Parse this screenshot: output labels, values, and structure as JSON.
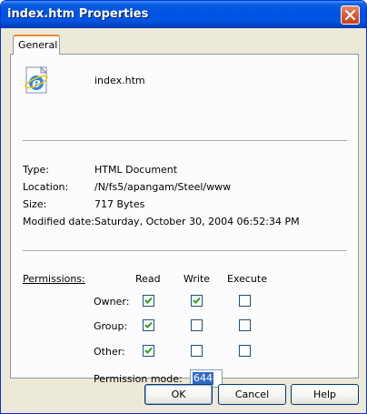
{
  "window": {
    "title": "index.htm Properties",
    "close_icon": "close-icon"
  },
  "tabs": [
    {
      "label": "General",
      "selected": true
    }
  ],
  "file": {
    "icon": "ie-html-file-icon",
    "name": "index.htm"
  },
  "properties": [
    {
      "label": "Type:",
      "value": "HTML Document"
    },
    {
      "label": "Location:",
      "value": "/N/fs5/apangam/Steel/www"
    },
    {
      "label": "Size:",
      "value": "717 Bytes"
    },
    {
      "label": "Modified date:",
      "value": "Saturday, October 30, 2004 06:52:34 PM"
    }
  ],
  "permissions": {
    "label": "Permissions:",
    "columns": [
      "Read",
      "Write",
      "Execute"
    ],
    "rows": [
      {
        "label": "Owner:",
        "read": true,
        "write": true,
        "execute": false
      },
      {
        "label": "Group:",
        "read": true,
        "write": false,
        "execute": false
      },
      {
        "label": "Other:",
        "read": true,
        "write": false,
        "execute": false
      }
    ],
    "mode_label": "Permission mode:",
    "mode_value": "644"
  },
  "buttons": {
    "ok": "OK",
    "cancel": "Cancel",
    "help": "Help"
  },
  "colors": {
    "titlebar": "#0054e3",
    "face": "#ece9d8",
    "selection": "#316ac5"
  }
}
